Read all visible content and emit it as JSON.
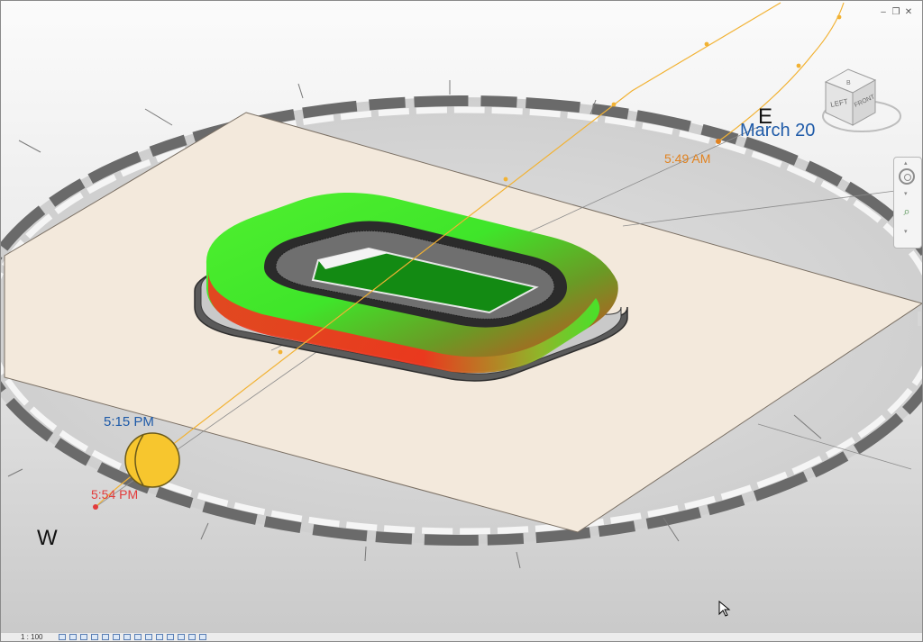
{
  "window": {
    "controls": {
      "minimize": "–",
      "restore": "❐",
      "close": "✕"
    }
  },
  "compass": {
    "east": "E",
    "west": "W"
  },
  "sun_path": {
    "date": "March 20",
    "sunrise_time": "5:49 AM",
    "sun_time": "5:15 PM",
    "sunset_time": "5:54 PM",
    "path_color": "#f2b233",
    "sunrise_color": "#e1821f",
    "sun_color_label": "#1e5aa8",
    "sunset_color": "#e23b3b"
  },
  "viewcube": {
    "left_face": "LEFT",
    "front_face": "FRONT",
    "top_face": "B"
  },
  "model": {
    "stadium_exterior_color": "#44ee2a",
    "stadium_shadow_color": "#e23a20",
    "pitch_color": "#138a13",
    "site_color": "#f3e9dc"
  },
  "statusbar": {
    "scale": "1 : 100"
  },
  "icons": {
    "nav_wheel": "steering-wheel-icon",
    "nav_zoom": "zoom-icon",
    "cursor": "mouse-pointer-icon"
  }
}
